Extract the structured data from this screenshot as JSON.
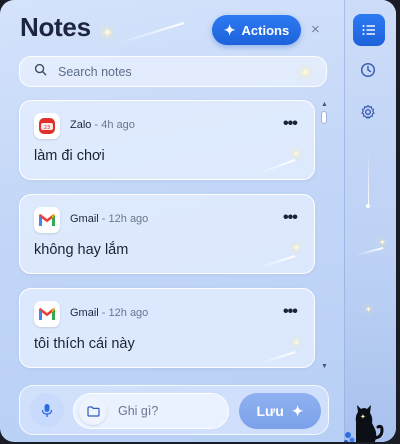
{
  "header": {
    "title": "Notes",
    "actions_label": "Actions",
    "close_symbol": "×"
  },
  "search": {
    "placeholder": "Search notes"
  },
  "notes": [
    {
      "source": "Zalo",
      "time": "4h ago",
      "text": "làm đi chơi",
      "icon": "zalo-icon"
    },
    {
      "source": "Gmail",
      "time": "12h ago",
      "text": "không hay lắm",
      "icon": "gmail-icon"
    },
    {
      "source": "Gmail",
      "time": "12h ago",
      "text": "tôi thích cái này",
      "icon": "gmail-icon"
    }
  ],
  "composer": {
    "placeholder": "Ghi gì?",
    "save_label": "Lưu"
  },
  "rail": {
    "items": [
      "list-icon",
      "clock-icon",
      "gear-icon"
    ]
  },
  "colors": {
    "accent": "#1f6ae0",
    "save": "#7ea4ec",
    "gmail_red": "#ea4335",
    "zalo_red": "#e0302b"
  }
}
